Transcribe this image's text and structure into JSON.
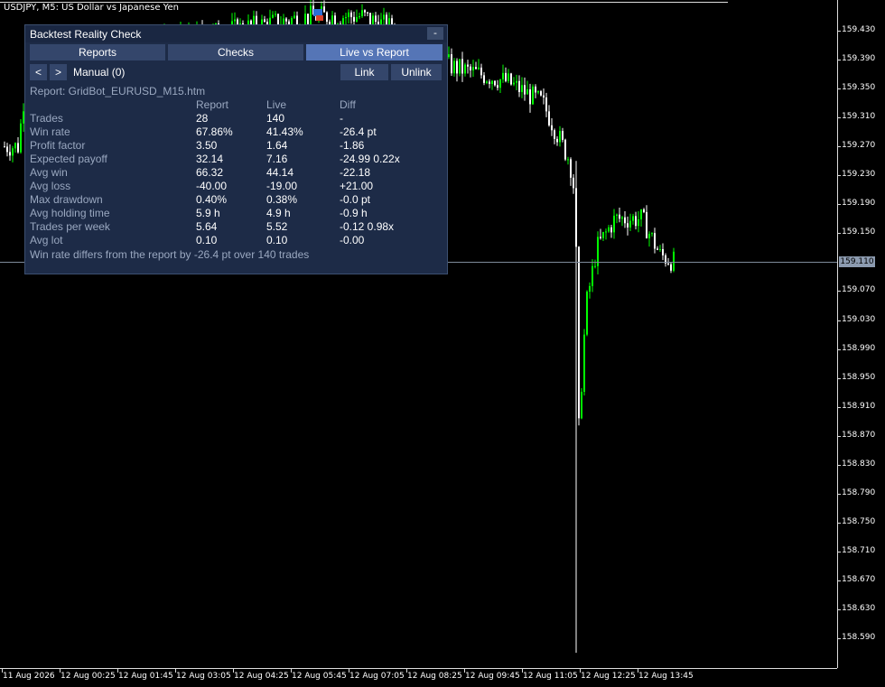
{
  "chart": {
    "symbol_title": "USDJPY, M5:  US Dollar vs Japanese Yen",
    "current_price": "159.110",
    "price_ticks": [
      "159.430",
      "159.390",
      "159.350",
      "159.310",
      "159.270",
      "159.230",
      "159.190",
      "159.150",
      "159.070",
      "159.030",
      "158.990",
      "158.950",
      "158.910",
      "158.870",
      "158.830",
      "158.790",
      "158.750",
      "158.710",
      "158.670",
      "158.630",
      "158.590"
    ],
    "time_ticks": [
      "11 Aug 2026",
      "12 Aug 00:25",
      "12 Aug 01:45",
      "12 Aug 03:05",
      "12 Aug 04:25",
      "12 Aug 05:45",
      "12 Aug 07:05",
      "12 Aug 08:25",
      "12 Aug 09:45",
      "12 Aug 11:05",
      "12 Aug 12:25",
      "12 Aug 13:45"
    ],
    "colors": {
      "bull": "#00ff00",
      "bear": "#ffffff",
      "background": "#000000",
      "grid_line": "#7f8b9b"
    }
  },
  "panel": {
    "title": "Backtest Reality Check",
    "minimize_label": "-",
    "tabs": [
      {
        "label": "Reports",
        "active": false
      },
      {
        "label": "Checks",
        "active": false
      },
      {
        "label": "Live vs Report",
        "active": true
      }
    ],
    "prev_label": "<",
    "next_label": ">",
    "manual_label": "Manual (0)",
    "link_label": "Link",
    "unlink_label": "Unlink",
    "report_line": "Report: GridBot_EURUSD_M15.htm",
    "headers": {
      "report": "Report",
      "live": "Live",
      "diff": "Diff"
    },
    "rows": [
      {
        "label": "Trades",
        "report": "28",
        "live": "140",
        "diff": "-"
      },
      {
        "label": "Win rate",
        "report": "67.86%",
        "live": "41.43%",
        "diff": "-26.4 pt"
      },
      {
        "label": "Profit factor",
        "report": "3.50",
        "live": "1.64",
        "diff": "-1.86"
      },
      {
        "label": "Expected payoff",
        "report": "32.14",
        "live": "7.16",
        "diff": "-24.99  0.22x"
      },
      {
        "label": "Avg win",
        "report": "66.32",
        "live": "44.14",
        "diff": "-22.18"
      },
      {
        "label": "Avg loss",
        "report": "-40.00",
        "live": "-19.00",
        "diff": "+21.00"
      },
      {
        "label": "Max drawdown",
        "report": "0.40%",
        "live": "0.38%",
        "diff": "-0.0 pt"
      },
      {
        "label": "Avg holding time",
        "report": "5.9 h",
        "live": "4.9 h",
        "diff": "-0.9 h"
      },
      {
        "label": "Trades per week",
        "report": "5.64",
        "live": "5.52",
        "diff": "-0.12  0.98x"
      },
      {
        "label": "Avg lot",
        "report": "0.10",
        "live": "0.10",
        "diff": "-0.00"
      }
    ],
    "summary": "Win rate differs from the report by -26.4 pt over 140 trades"
  }
}
